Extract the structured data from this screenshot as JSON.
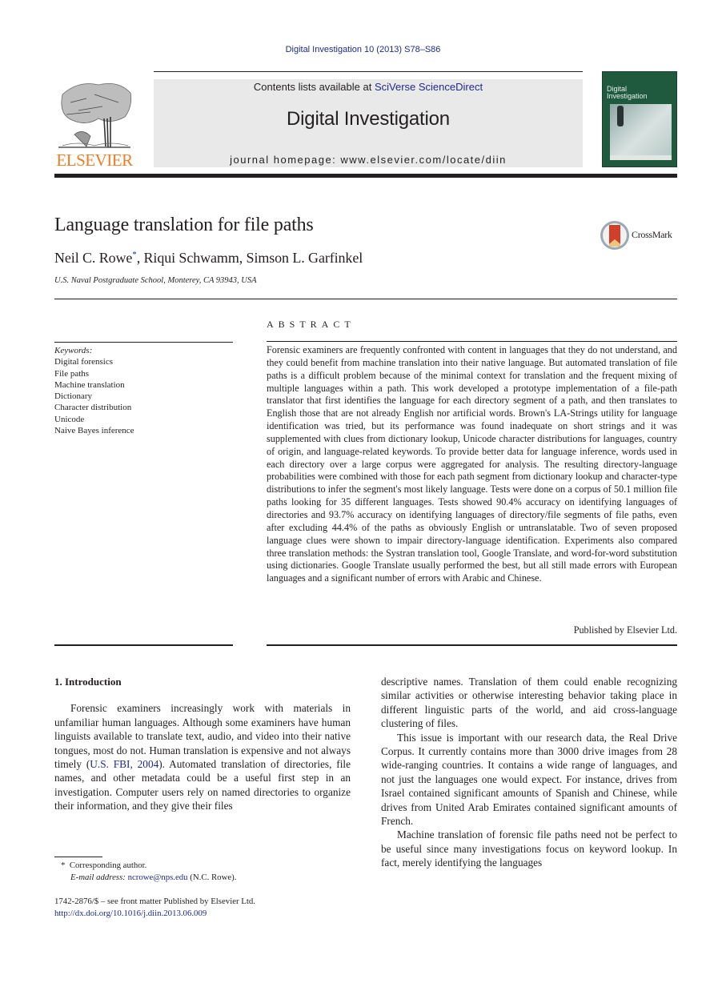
{
  "header": {
    "citation": "Digital Investigation 10 (2013) S78–S86",
    "contents_prefix": "Contents lists available at ",
    "contents_link": "SciVerse ScienceDirect",
    "journal_title": "Digital Investigation",
    "homepage": "journal homepage: www.elsevier.com/locate/diin",
    "publisher_logo_text": "ELSEVIER",
    "cover_title_line1": "Digital",
    "cover_title_line2": "Investigation"
  },
  "article": {
    "title": "Language translation for file paths",
    "crossmark_label": "CrossMark",
    "authors": [
      {
        "name": "Neil C. Rowe",
        "marker": "*"
      },
      {
        "name": "Riqui Schwamm",
        "marker": ""
      },
      {
        "name": "Simson L. Garfinkel",
        "marker": ""
      }
    ],
    "author_sep": ", ",
    "affiliation": "U.S. Naval Postgraduate School, Monterey, CA 93943, USA"
  },
  "keywords": {
    "label": "Keywords:",
    "items": [
      "Digital forensics",
      "File paths",
      "Machine translation",
      "Dictionary",
      "Character distribution",
      "Unicode",
      "Naive Bayes inference"
    ]
  },
  "abstract": {
    "heading": "ABSTRACT",
    "text": "Forensic examiners are frequently confronted with content in languages that they do not understand, and they could benefit from machine translation into their native language. But automated translation of file paths is a difficult problem because of the minimal context for translation and the frequent mixing of multiple languages within a path. This work developed a prototype implementation of a file-path translator that first identifies the language for each directory segment of a path, and then translates to English those that are not already English nor artificial words. Brown's LA-Strings utility for language identification was tried, but its performance was found inadequate on short strings and it was supplemented with clues from dictionary lookup, Unicode character distributions for languages, country of origin, and language-related keywords. To provide better data for language inference, words used in each directory over a large corpus were aggregated for analysis. The resulting directory-language probabilities were combined with those for each path segment from dictionary lookup and character-type distributions to infer the segment's most likely language. Tests were done on a corpus of 50.1 million file paths looking for 35 different languages. Tests showed 90.4% accuracy on identifying languages of directories and 93.7% accuracy on identifying languages of directory/file segments of file paths, even after excluding 44.4% of the paths as obviously English or untranslatable. Two of seven proposed language clues were shown to impair directory-language identification. Experiments also compared three translation methods: the Systran translation tool, Google Translate, and word-for-word substitution using dictionaries. Google Translate usually performed the best, but all still made errors with European languages and a significant number of errors with Arabic and Chinese.",
    "publisher_note": "Published by Elsevier Ltd."
  },
  "body": {
    "section_heading": "1.  Introduction",
    "left_p1_before": "Forensic examiners increasingly work with materials in unfamiliar human languages. Although some examiners have human linguists available to translate text, audio, and video into their native tongues, most do not. Human translation is expensive and not always timely (",
    "left_p1_cite": "U.S. FBI, 2004",
    "left_p1_after": "). Automated translation of directories, file names, and other metadata could be a useful first step in an investigation. Computer users rely on named directories to organize their information, and they give their files",
    "right_p1": "descriptive names. Translation of them could enable recognizing similar activities or otherwise interesting behavior taking place in different linguistic parts of the world, and aid cross-language clustering of files.",
    "right_p2": "This issue is important with our research data, the Real Drive Corpus. It currently contains more than 3000 drive images from 28 wide-ranging countries. It contains a wide range of languages, and not just the languages one would expect. For instance, drives from Israel contained significant amounts of Spanish and Chinese, while drives from United Arab Emirates contained significant amounts of French.",
    "right_p3": "Machine translation of forensic file paths need not be perfect to be useful since many investigations focus on keyword lookup. In fact, merely identifying the languages"
  },
  "footnote": {
    "marker": "*",
    "corresponding": "Corresponding author.",
    "email_label": "E-mail address:",
    "email": "ncrowe@nps.edu",
    "email_suffix": " (N.C. Rowe)."
  },
  "footer": {
    "issn_line": "1742-2876/$ – see front matter Published by Elsevier Ltd.",
    "doi": "http://dx.doi.org/10.1016/j.diin.2013.06.009"
  },
  "colors": {
    "link": "#1f2a8c",
    "elsevier_orange": "#f07c22",
    "banner_bg": "#e9e9e9",
    "cover_green": "#1f5a3e"
  }
}
